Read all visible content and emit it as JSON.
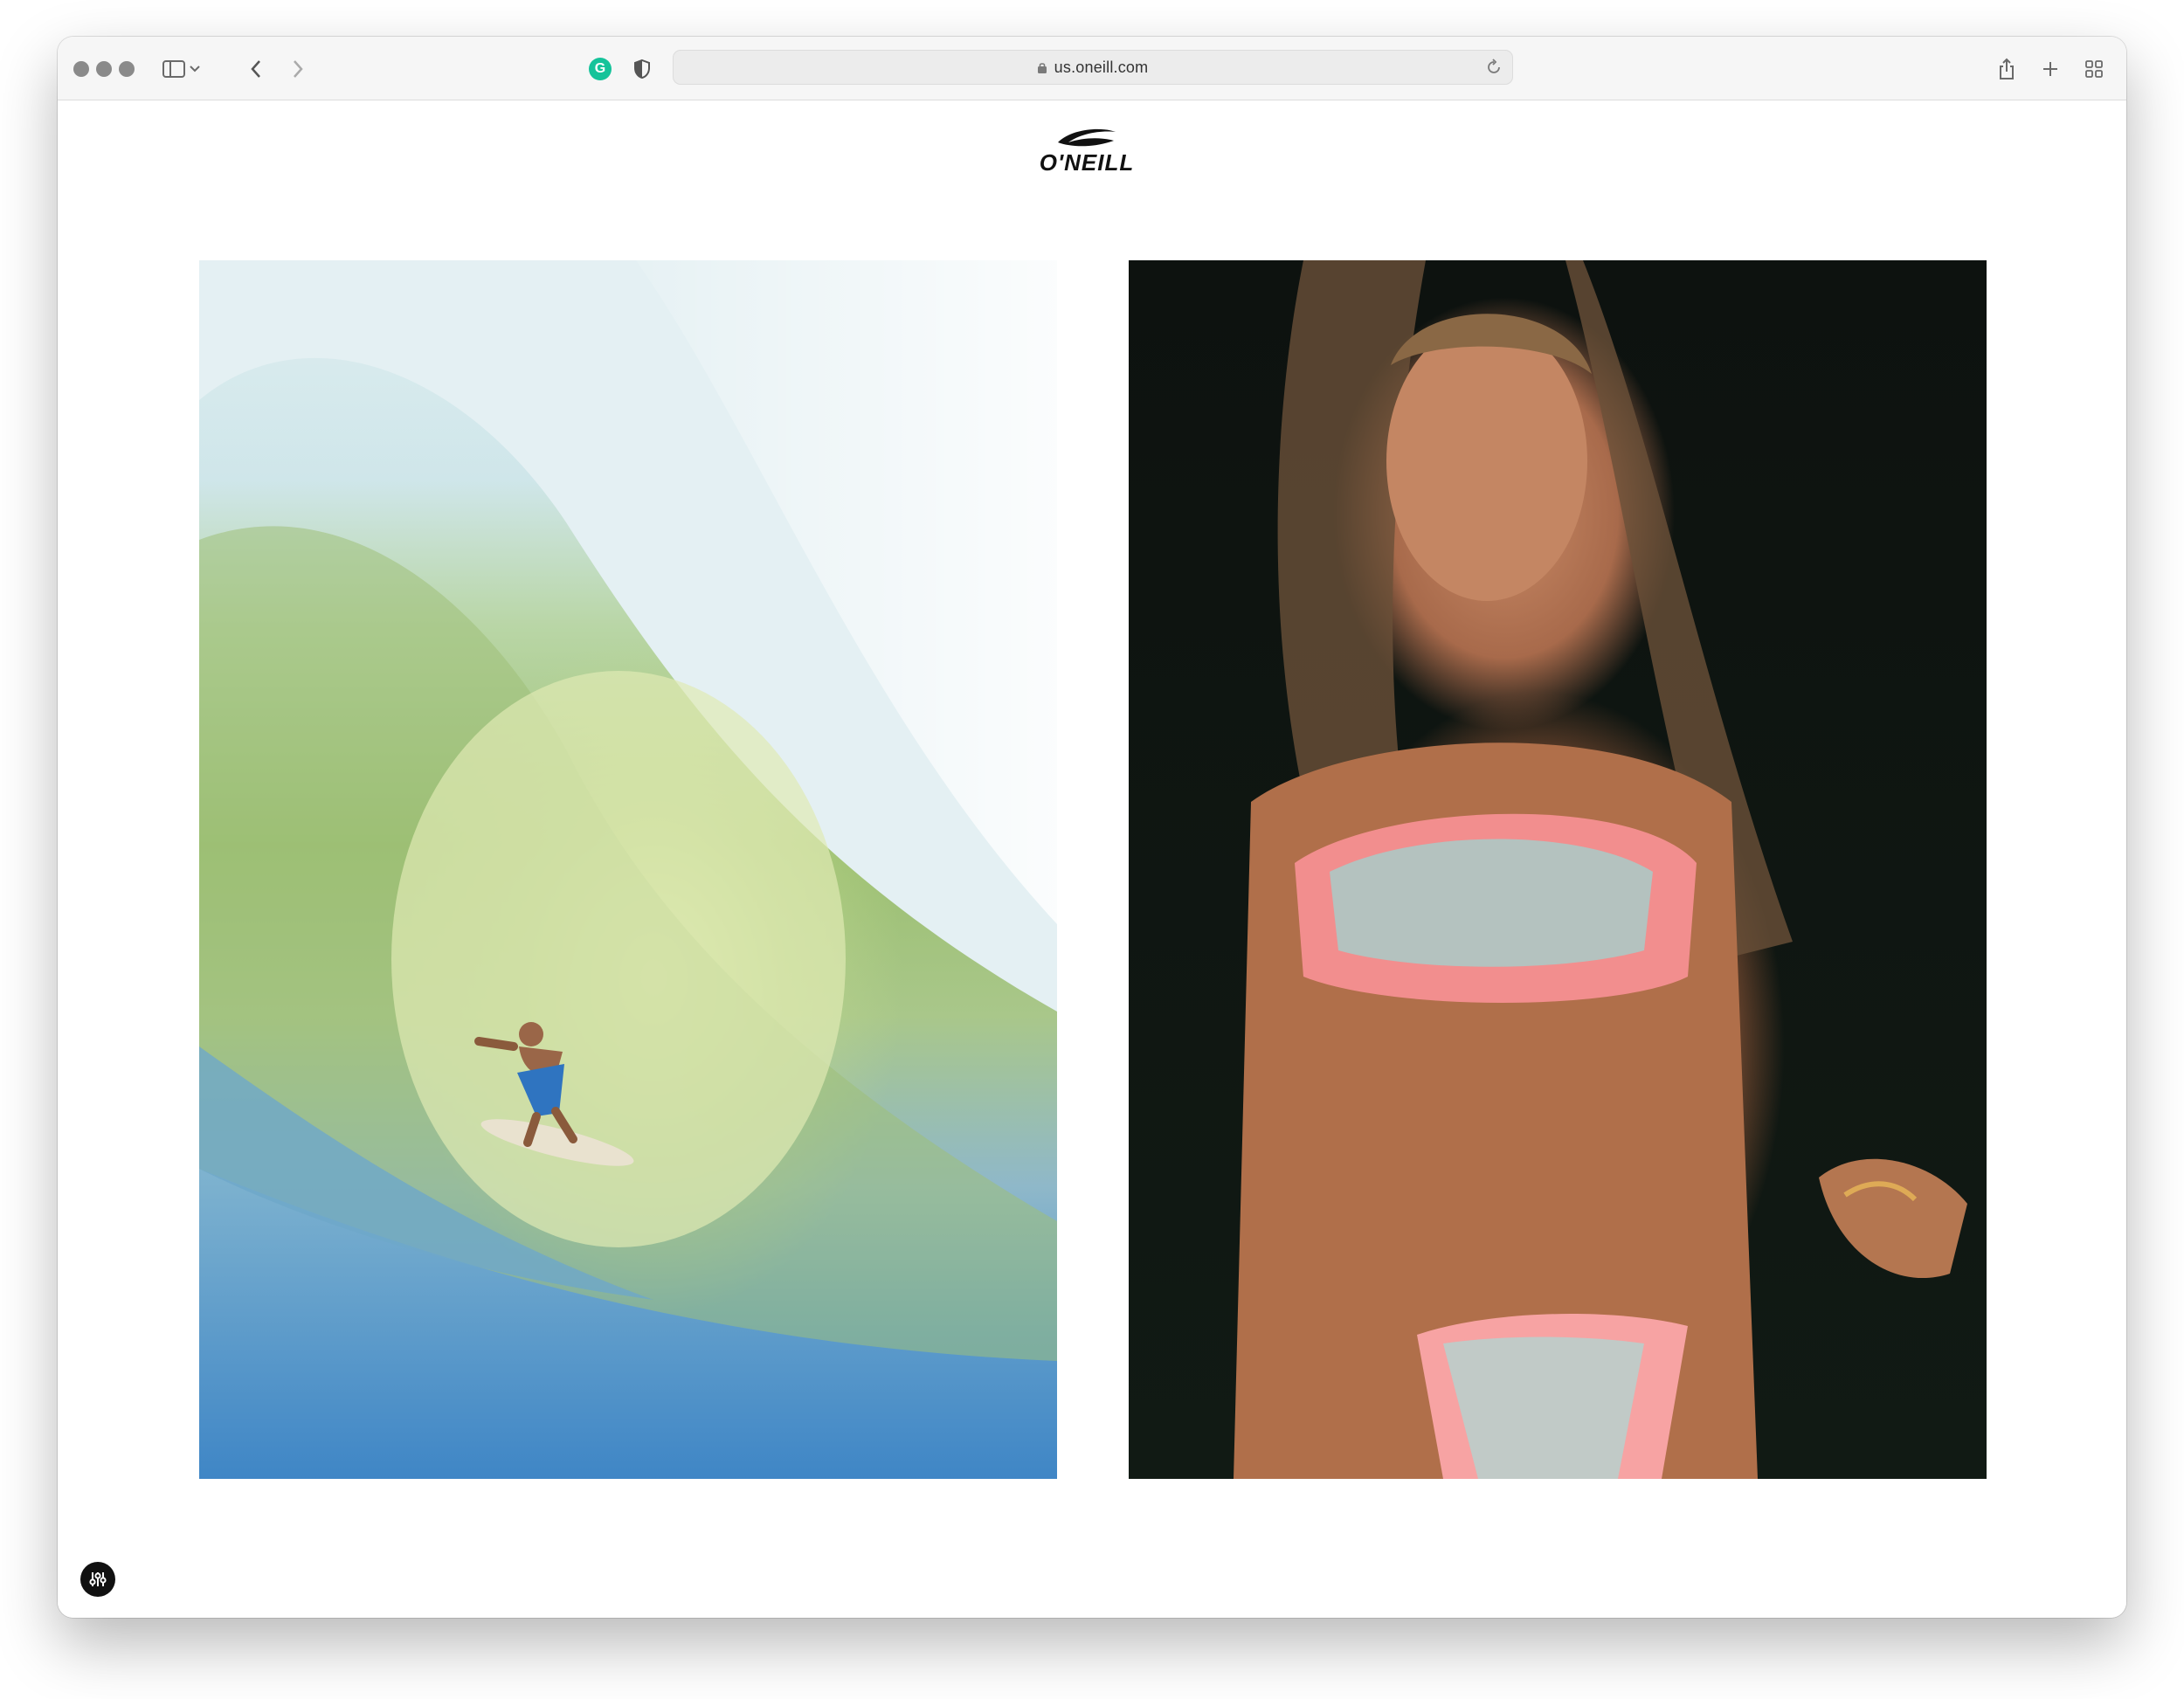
{
  "browser": {
    "url": "us.oneill.com",
    "icons": {
      "sidebar": "sidebar-icon",
      "chevron": "chevron-down-icon",
      "back": "back-icon",
      "forward": "forward-icon",
      "extension": "grammarly-icon",
      "privacy": "shield-icon",
      "lock": "lock-icon",
      "reload": "reload-icon",
      "share": "share-icon",
      "new_tab": "plus-icon",
      "tabs": "tab-overview-icon"
    },
    "extension_letter": "G"
  },
  "page": {
    "brand": "O'NEILL",
    "images": [
      {
        "name": "surfer-in-barrel-wave"
      },
      {
        "name": "model-in-floral-bikini"
      }
    ],
    "floating_button_icon": "settings-sliders-icon"
  }
}
